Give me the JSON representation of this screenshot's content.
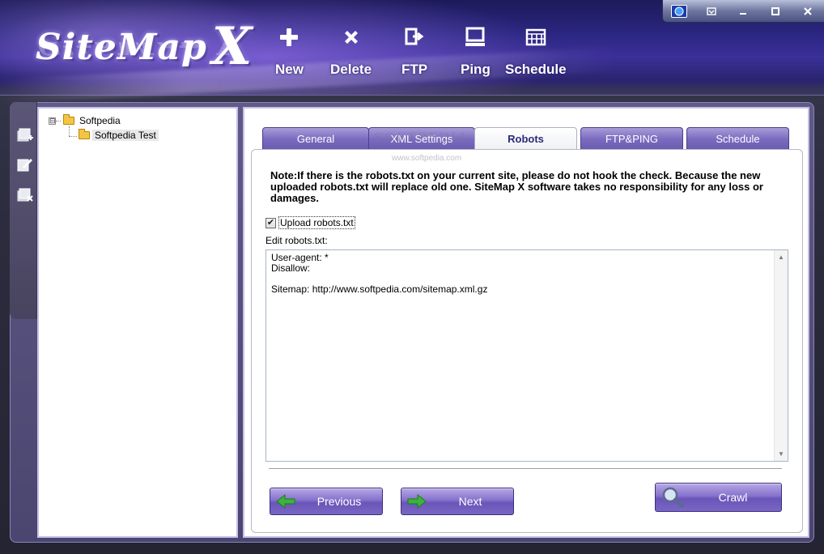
{
  "app": {
    "logo_text": "SiteMap",
    "logo_x": "X"
  },
  "toolbar": {
    "items": [
      {
        "label": "New",
        "icon": "plus-icon"
      },
      {
        "label": "Delete",
        "icon": "x-icon"
      },
      {
        "label": "FTP",
        "icon": "ftp-export-icon"
      },
      {
        "label": "Ping",
        "icon": "monitor-icon"
      },
      {
        "label": "Schedule",
        "icon": "calendar-icon"
      }
    ]
  },
  "window_controls": [
    "globe-icon",
    "dropdown-icon",
    "minimize-icon",
    "maximize-icon",
    "close-icon"
  ],
  "sidebar": {
    "icons": [
      "add-site-icon",
      "edit-site-icon",
      "delete-site-icon"
    ]
  },
  "tree": {
    "root": {
      "label": "Softpedia",
      "expander": "⊟"
    },
    "child": {
      "label": "Softpedia Test"
    }
  },
  "tabs": [
    {
      "label": "General",
      "active": false
    },
    {
      "label": "XML Settings",
      "active": false
    },
    {
      "label": "Robots",
      "active": true
    },
    {
      "label": "FTP&PING",
      "active": false
    },
    {
      "label": "Schedule",
      "active": false
    }
  ],
  "robots": {
    "note": "Note:If there is the robots.txt on your current site, please do not hook the check. Because the new uploaded robots.txt will replace old one. SiteMap X software takes no responsibility for any loss or damages.",
    "upload_label": "Upload robots.txt",
    "upload_checked": true,
    "edit_label": "Edit robots.txt:",
    "content": "User-agent: *\nDisallow:\n\nSitemap: http://www.softpedia.com/sitemap.xml.gz"
  },
  "buttons": {
    "previous": "Previous",
    "next": "Next",
    "crawl": "Crawl"
  },
  "watermark": {
    "main": "SOFTPEDIA",
    "sub": "www.softpedia.com"
  },
  "colors": {
    "accent": "#7b6cc0",
    "header": "#2a2680",
    "arrow_green": "#3cb43c"
  }
}
